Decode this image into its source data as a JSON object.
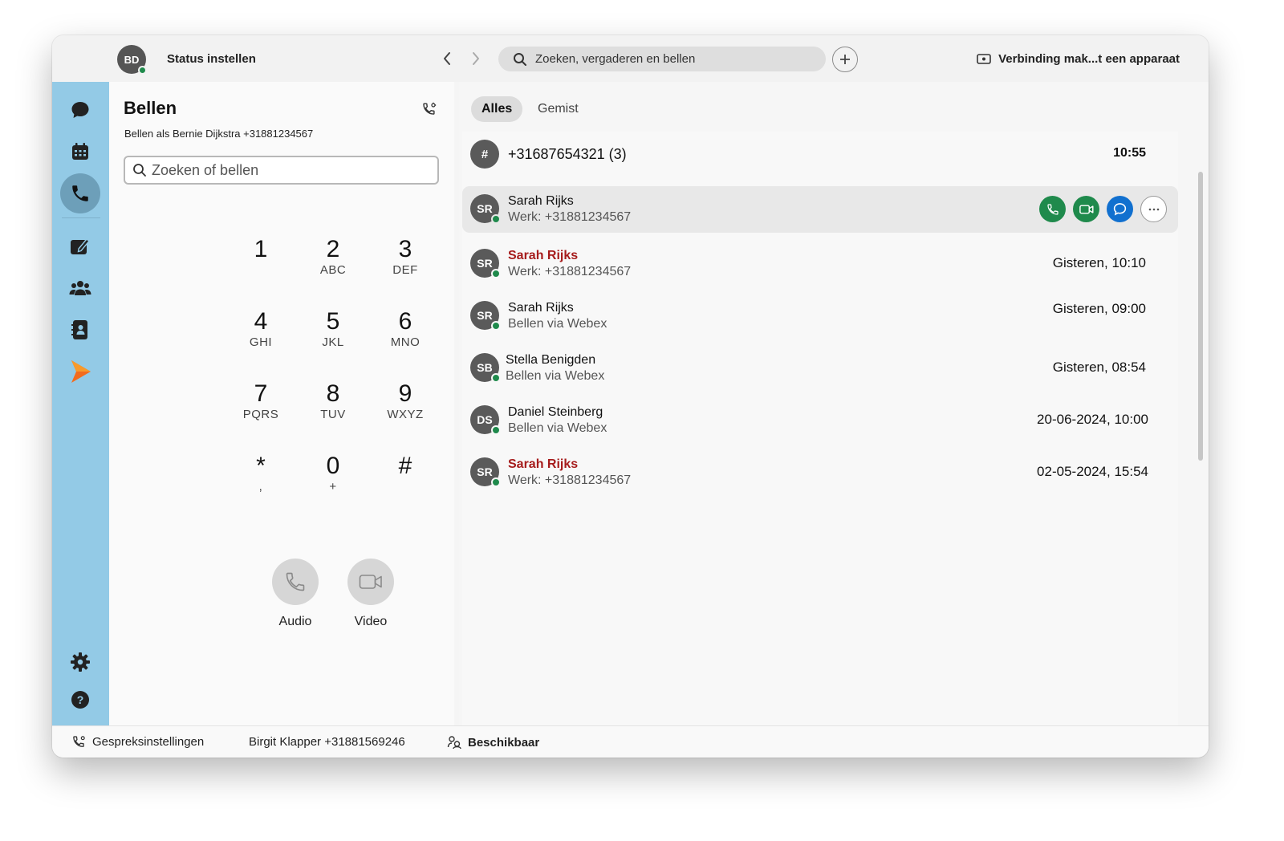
{
  "colors": {
    "sidebar": "#93cae6",
    "presence_available": "#1f8a4c",
    "missed_call": "#a61c1c",
    "chat_blue": "#1170cf",
    "brand_orange": "#f26b1d"
  },
  "titlebar": {
    "user_initials": "BD",
    "status_label": "Status instellen",
    "search_placeholder": "Zoeken, vergaderen en bellen",
    "device_connect_label": "Verbinding mak...t een apparaat"
  },
  "sidebar": {
    "items": [
      {
        "name": "messaging",
        "icon": "chat-bubble-icon"
      },
      {
        "name": "calendar",
        "icon": "calendar-icon"
      },
      {
        "name": "calling",
        "icon": "phone-icon",
        "active": true
      },
      {
        "name": "whiteboard",
        "icon": "edit-board-icon"
      },
      {
        "name": "teams",
        "icon": "people-icon"
      },
      {
        "name": "contacts",
        "icon": "contact-book-icon"
      },
      {
        "name": "app",
        "icon": "arrow-logo-icon"
      },
      {
        "name": "settings",
        "icon": "gear-icon"
      },
      {
        "name": "help",
        "icon": "help-icon"
      }
    ]
  },
  "dialpad": {
    "title": "Bellen",
    "caller_id": "Bellen als Bernie Dijkstra +31881234567",
    "search_placeholder": "Zoeken of bellen",
    "keys": [
      {
        "digit": "1",
        "letters": ""
      },
      {
        "digit": "2",
        "letters": "ABC"
      },
      {
        "digit": "3",
        "letters": "DEF"
      },
      {
        "digit": "4",
        "letters": "GHI"
      },
      {
        "digit": "5",
        "letters": "JKL"
      },
      {
        "digit": "6",
        "letters": "MNO"
      },
      {
        "digit": "7",
        "letters": "PQRS"
      },
      {
        "digit": "8",
        "letters": "TUV"
      },
      {
        "digit": "9",
        "letters": "WXYZ"
      },
      {
        "digit": "*",
        "letters": ","
      },
      {
        "digit": "0",
        "letters": "+"
      },
      {
        "digit": "#",
        "letters": ""
      }
    ],
    "audio_label": "Audio",
    "video_label": "Video"
  },
  "history": {
    "tabs": [
      {
        "label": "Alles",
        "active": true
      },
      {
        "label": "Gemist",
        "active": false
      }
    ],
    "entries": [
      {
        "avatar": "#",
        "name": "+31687654321 (3)",
        "subtitle": "",
        "time": "10:55",
        "missed": false,
        "presence": false
      },
      {
        "avatar": "SR",
        "name": "Sarah Rijks",
        "subtitle": "Werk: +31881234567",
        "time": "",
        "missed": false,
        "presence": true,
        "highlighted": true
      },
      {
        "avatar": "SR",
        "name": "Sarah Rijks",
        "subtitle": "Werk: +31881234567",
        "time": "Gisteren, 10:10",
        "missed": true,
        "presence": true
      },
      {
        "avatar": "SR",
        "name": "Sarah Rijks",
        "subtitle": "Bellen via Webex",
        "time": "Gisteren, 09:00",
        "missed": false,
        "presence": true
      },
      {
        "avatar": "SB",
        "name": "Stella Benigden",
        "subtitle": "Bellen via Webex",
        "time": "Gisteren, 08:54",
        "missed": false,
        "presence": true
      },
      {
        "avatar": "DS",
        "name": "Daniel Steinberg",
        "subtitle": "Bellen via Webex",
        "time": "20-06-2024, 10:00",
        "missed": false,
        "presence": true
      },
      {
        "avatar": "SR",
        "name": "Sarah Rijks",
        "subtitle": "Werk: +31881234567",
        "time": "02-05-2024, 15:54",
        "missed": true,
        "presence": true
      }
    ],
    "row_actions": [
      "phone-icon",
      "video-icon",
      "chat-icon",
      "more-icon"
    ]
  },
  "statusbar": {
    "call_settings_label": "Gespreksinstellingen",
    "line_label": "Birgit Klapper +31881569246",
    "availability_label": "Beschikbaar"
  }
}
